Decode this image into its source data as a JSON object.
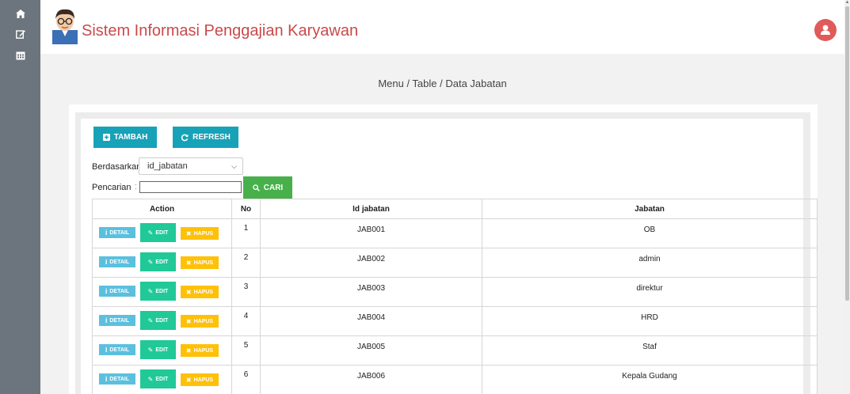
{
  "app": {
    "title": "Sistem Informasi Penggajian Karyawan"
  },
  "rail": {
    "items": [
      "home-icon",
      "edit-icon",
      "calendar-icon"
    ]
  },
  "breadcrumb": "Menu / Table / Data Jabatan",
  "toolbar": {
    "tambah_label": "TAMBAH",
    "refresh_label": "REFRESH"
  },
  "filter": {
    "berdasarkan_label": "Berdasarkan:",
    "selected_field": "id_jabatan",
    "pencarian_label": "Pencarian",
    "pencarian_colon": ":",
    "search_value": "",
    "cari_label": "CARI"
  },
  "table": {
    "columns": [
      "Action",
      "No",
      "Id jabatan",
      "Jabatan"
    ],
    "action_labels": {
      "detail": "DETAIL",
      "edit": "EDIT",
      "hapus": "HAPUS"
    },
    "rows": [
      {
        "no": "1",
        "id": "JAB001",
        "jabatan": "OB"
      },
      {
        "no": "2",
        "id": "JAB002",
        "jabatan": "admin"
      },
      {
        "no": "3",
        "id": "JAB003",
        "jabatan": "direktur"
      },
      {
        "no": "4",
        "id": "JAB004",
        "jabatan": "HRD"
      },
      {
        "no": "5",
        "id": "JAB005",
        "jabatan": "Staf"
      },
      {
        "no": "6",
        "id": "JAB006",
        "jabatan": "Kepala Gudang"
      }
    ]
  },
  "colors": {
    "rail": "#6c757d",
    "title": "#c94a4a",
    "info": "#17a2b8",
    "success": "#47b04b",
    "edit": "#20c997",
    "warning": "#ffc107",
    "detail": "#5bc0de"
  }
}
